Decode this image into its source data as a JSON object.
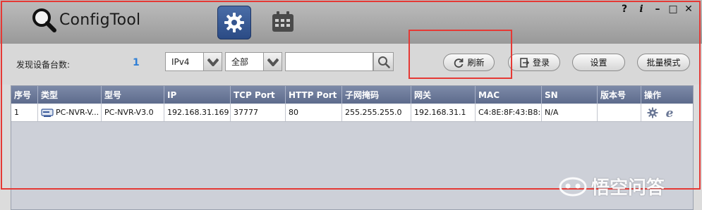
{
  "app": {
    "title": "ConfigTool"
  },
  "nav": [
    {
      "name": "settings",
      "icon": "gear-icon",
      "active": true
    },
    {
      "name": "schedule",
      "icon": "calendar-icon",
      "active": false
    }
  ],
  "window_controls": {
    "help": "?",
    "info": "i",
    "minimize": "–",
    "maximize": "□",
    "close": "✕"
  },
  "toolbar": {
    "found_label": "发现设备台数:",
    "found_count": "1",
    "ip_version": {
      "selected": "IPv4"
    },
    "scope": {
      "selected": "全部"
    },
    "search": {
      "value": ""
    },
    "refresh_label": "刷新",
    "login_label": "登录",
    "settings_label": "设置",
    "batch_label": "批量模式"
  },
  "table": {
    "columns": [
      "序号",
      "类型",
      "型号",
      "IP",
      "TCP Port",
      "HTTP Port",
      "子网掩码",
      "网关",
      "MAC",
      "SN",
      "版本号",
      "操作"
    ],
    "rows": [
      {
        "no": "1",
        "type": "PC-NVR-V...",
        "model": "PC-NVR-V3.0",
        "ip": "192.168.31.169",
        "tcp": "37777",
        "http": "80",
        "mask": "255.255.255.0",
        "gateway": "192.168.31.1",
        "mac": "C4:8E:8F:43:B8:...",
        "sn": "N/A",
        "version": ""
      }
    ]
  },
  "watermark": {
    "text": "悟空问答"
  },
  "colors": {
    "accent_blue": "#2f7fd6",
    "header_bg": "#6a7796",
    "highlight": "#e53935",
    "nav_active": "#34558f"
  }
}
